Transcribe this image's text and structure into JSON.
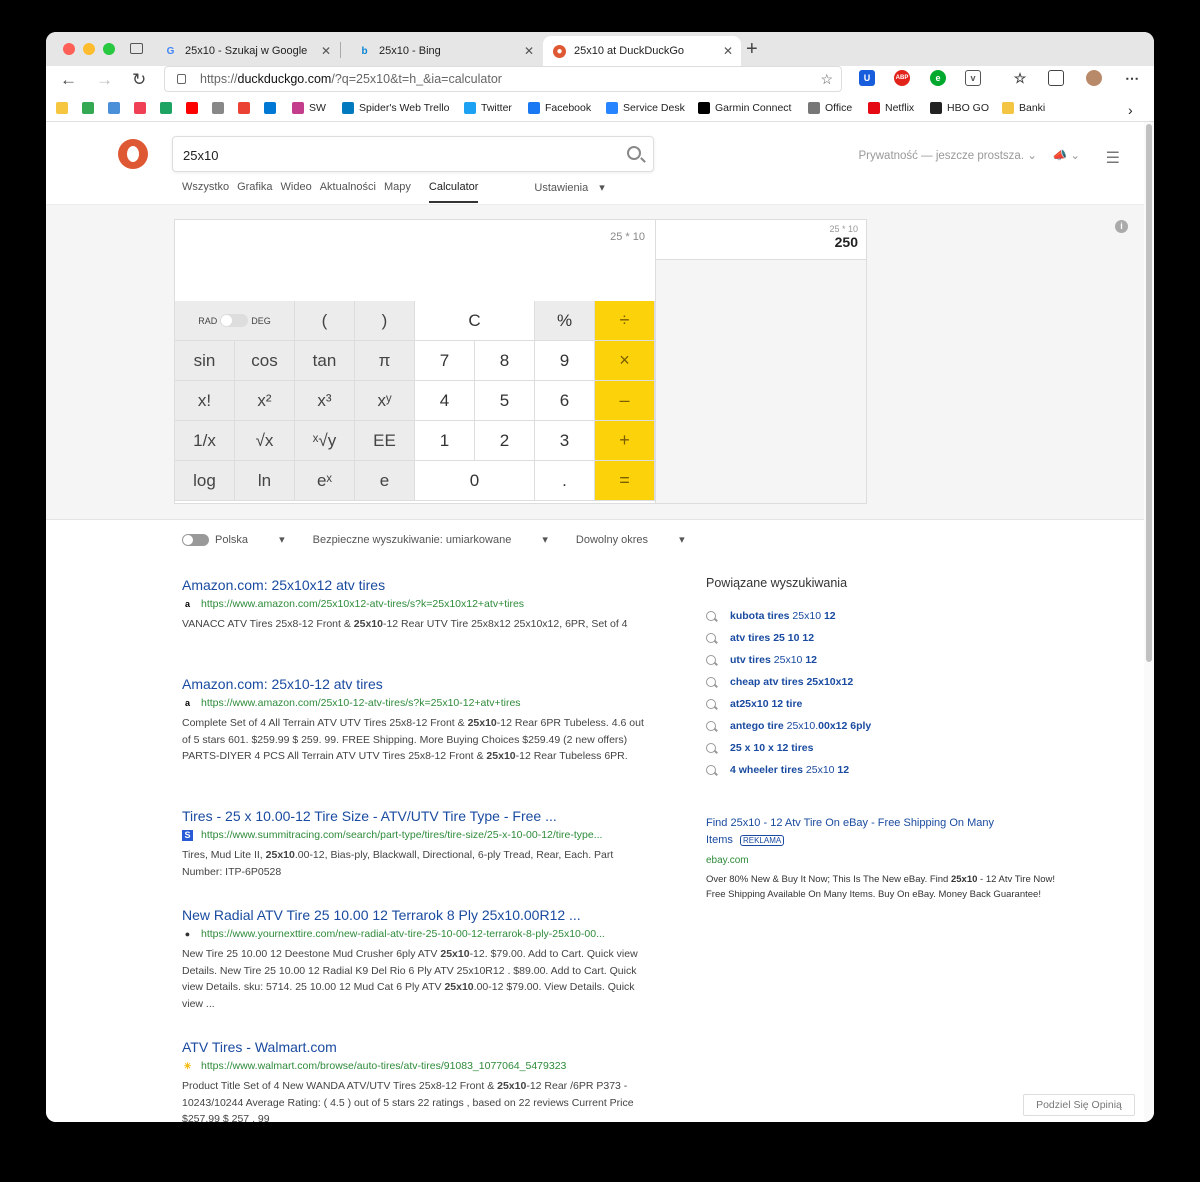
{
  "browser": {
    "tabs": [
      {
        "title": "25x10 - Szukaj w Google",
        "favicon": "google-icon"
      },
      {
        "title": "25x10 - Bing",
        "favicon": "bing-icon"
      },
      {
        "title": "25x10 at DuckDuckGo",
        "favicon": "duckduckgo-icon",
        "active": true
      }
    ],
    "url_prefix": "https://",
    "url_host": "duckduckgo.com",
    "url_path": "/?q=25x10&t=h_&ia=calculator"
  },
  "bookmarks": [
    {
      "label": "",
      "color": "#f7c640"
    },
    {
      "label": "",
      "color": "#34a853"
    },
    {
      "label": "",
      "color": "#4a90d9"
    },
    {
      "label": "",
      "color": "#ef4056"
    },
    {
      "label": "",
      "color": "#1da462"
    },
    {
      "label": "",
      "color": "#ff0000"
    },
    {
      "label": "",
      "color": "#888888"
    },
    {
      "label": "",
      "color": "#ea4335"
    },
    {
      "label": "",
      "color": "#0078d4"
    },
    {
      "label": "SW",
      "color": "#c33d8c"
    },
    {
      "label": "Spider's Web Trello",
      "color": "#0079bf"
    },
    {
      "label": "Twitter",
      "color": "#1da1f2"
    },
    {
      "label": "Facebook",
      "color": "#1877f2"
    },
    {
      "label": "Service Desk",
      "color": "#2684ff"
    },
    {
      "label": "Garmin Connect",
      "color": "#000000"
    },
    {
      "label": "Office",
      "color": "#777777"
    },
    {
      "label": "Netflix",
      "color": "#e50914"
    },
    {
      "label": "HBO GO",
      "color": "#222222"
    },
    {
      "label": "Banki",
      "color": "#f4c542"
    }
  ],
  "search": {
    "query": "25x10",
    "privacy": "Prywatność — jeszcze prostsza.",
    "tabs": [
      "Wszystko",
      "Grafika",
      "Wideo",
      "Aktualności",
      "Mapy"
    ],
    "active_tab": "Calculator",
    "settings": "Ustawienia"
  },
  "calculator": {
    "expression": "25 * 10",
    "result": "250",
    "mode_left": "RAD",
    "mode_right": "DEG",
    "keys": [
      [
        "(",
        ")",
        "C",
        "%",
        "÷"
      ],
      [
        "sin",
        "cos",
        "tan",
        "π",
        "7",
        "8",
        "9",
        "×"
      ],
      [
        "x!",
        "x²",
        "x³",
        "xʸ",
        "4",
        "5",
        "6",
        "–"
      ],
      [
        "1/x",
        "√x",
        "ˣ√y",
        "EE",
        "1",
        "2",
        "3",
        "+"
      ],
      [
        "log",
        "ln",
        "eˣ",
        "e",
        "0",
        ".",
        "="
      ]
    ],
    "history": [
      {
        "expression": "25 * 10",
        "result": "250"
      }
    ],
    "accent": "#fcd20b"
  },
  "filters": {
    "region": "Polska",
    "safe": "Bezpieczne wyszukiwanie: umiarkowane",
    "time": "Dowolny okres"
  },
  "results": [
    {
      "title": "Amazon.com: 25x10x12 atv tires",
      "url": "https://www.amazon.com/25x10x12-atv-tires/s?k=25x10x12+atv+tires",
      "icon": "a",
      "snippet": [
        "VANACC ATV Tires 25x8-12 Front & ",
        "25x10",
        "-12 Rear UTV Tire 25x8x12 25x10x12, 6PR, Set of 4"
      ]
    },
    {
      "title": "Amazon.com: 25x10-12 atv tires",
      "url": "https://www.amazon.com/25x10-12-atv-tires/s?k=25x10-12+atv+tires",
      "icon": "a",
      "snippet": [
        "Complete Set of 4 All Terrain ATV UTV Tires 25x8-12 Front & ",
        "25x10",
        "-12 Rear 6PR Tubeless. 4.6 out of 5 stars 601. $259.99 $ 259. 99. FREE Shipping. More Buying Choices $259.49 (2 new offers) PARTS-DIYER 4 PCS All Terrain ATV UTV Tires 25x8-12 Front & ",
        "25x10",
        "-12 Rear Tubeless 6PR."
      ]
    },
    {
      "title": "Tires - 25 x 10.00-12 Tire Size - ATV/UTV Tire Type - Free ...",
      "url": "https://www.summitracing.com/search/part-type/tires/tire-size/25-x-10-00-12/tire-type...",
      "icon": "S",
      "snippet": [
        "Tires, Mud Lite II, ",
        "25x10",
        ".00-12, Bias-ply, Blackwall, Directional, 6-ply Tread, Rear, Each. Part Number: ITP-6P0528"
      ]
    },
    {
      "title": "New Radial ATV Tire 25 10.00 12 Terrarok 8 Ply 25x10.00R12 ...",
      "url": "https://www.yournexttire.com/new-radial-atv-tire-25-10-00-12-terrarok-8-ply-25x10-00...",
      "icon": "●",
      "snippet": [
        "New Tire 25 10.00 12 Deestone Mud Crusher 6ply ATV ",
        "25x10",
        "-12. $79.00. Add to Cart. Quick view Details. New Tire 25 10.00 12 Radial K9 Del Rio 6 Ply ATV 25x10R12 . $89.00. Add to Cart. Quick view Details. sku: 5714. 25 10.00 12 Mud Cat 6 Ply ATV ",
        "25x10",
        ".00-12 $79.00. View Details. Quick view ..."
      ]
    },
    {
      "title": "ATV Tires - Walmart.com",
      "url": "https://www.walmart.com/browse/auto-tires/atv-tires/91083_1077064_5479323",
      "icon": "✳",
      "snippet": [
        "Product Title Set of 4 New WANDA ATV/UTV Tires 25x8-12 Front & ",
        "25x10",
        "-12 Rear /6PR P373 - 10243/10244 Average Rating: ( 4.5 ) out of 5 stars 22 ratings , based on 22 reviews Current Price $257.99 $ 257 . 99"
      ]
    }
  ],
  "related": {
    "title": "Powiązane wyszukiwania",
    "items": [
      [
        "kubota tires",
        " 25x10 ",
        "12"
      ],
      [
        "atv tires 25 10 12",
        "",
        ""
      ],
      [
        "utv tires",
        " 25x10 ",
        "12"
      ],
      [
        "cheap atv tires 25x10x12",
        "",
        ""
      ],
      [
        "at25x10 12 tire",
        "",
        ""
      ],
      [
        "antego tire",
        " 25x10.",
        "00x12 6ply"
      ],
      [
        "25 x 10 x 12 tires",
        "",
        ""
      ],
      [
        "4 wheeler tires",
        " 25x10 ",
        "12"
      ]
    ]
  },
  "ad": {
    "title": "Find 25x10 - 12 Atv Tire On eBay - Free Shipping On Many Items",
    "badge": "REKLAMA",
    "domain": "ebay.com",
    "snippet": [
      "Over 80% New & Buy It Now; This Is The New eBay. Find ",
      "25x10",
      " - 12 Atv Tire Now! Free Shipping Available On Many Items. Buy On eBay. Money Back Guarantee!"
    ]
  },
  "feedback": "Podziel Się Opinią"
}
